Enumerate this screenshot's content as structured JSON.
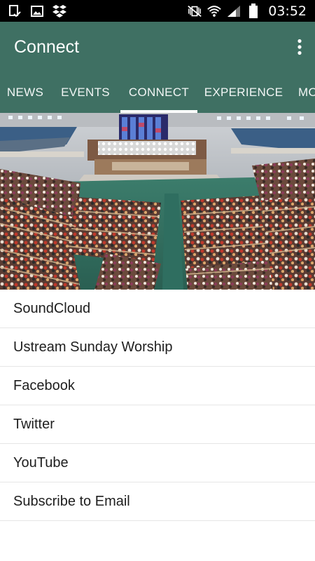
{
  "status_bar": {
    "time": "03:52",
    "left_icons": [
      "download-done-icon",
      "image-icon",
      "dropbox-icon"
    ],
    "right_icons": [
      "vibrate-mute-icon",
      "wifi-icon",
      "signal-icon",
      "battery-icon"
    ]
  },
  "app_bar": {
    "title": "Connect",
    "overflow_icon": "more-vert-icon"
  },
  "tabs": [
    {
      "label": "NEWS",
      "active": false
    },
    {
      "label": "EVENTS",
      "active": false
    },
    {
      "label": "CONNECT",
      "active": true
    },
    {
      "label": "EXPERIENCE",
      "active": false
    },
    {
      "label": "MO",
      "active": false
    }
  ],
  "colors": {
    "primary": "#3f7063",
    "status_bar": "#000000",
    "tab_indicator": "#ffffff",
    "carpet": "#2f6e60"
  },
  "links": [
    {
      "label": "SoundCloud"
    },
    {
      "label": "Ustream Sunday Worship"
    },
    {
      "label": "Facebook"
    },
    {
      "label": "Twitter"
    },
    {
      "label": "YouTube"
    },
    {
      "label": "Subscribe to Email"
    }
  ]
}
